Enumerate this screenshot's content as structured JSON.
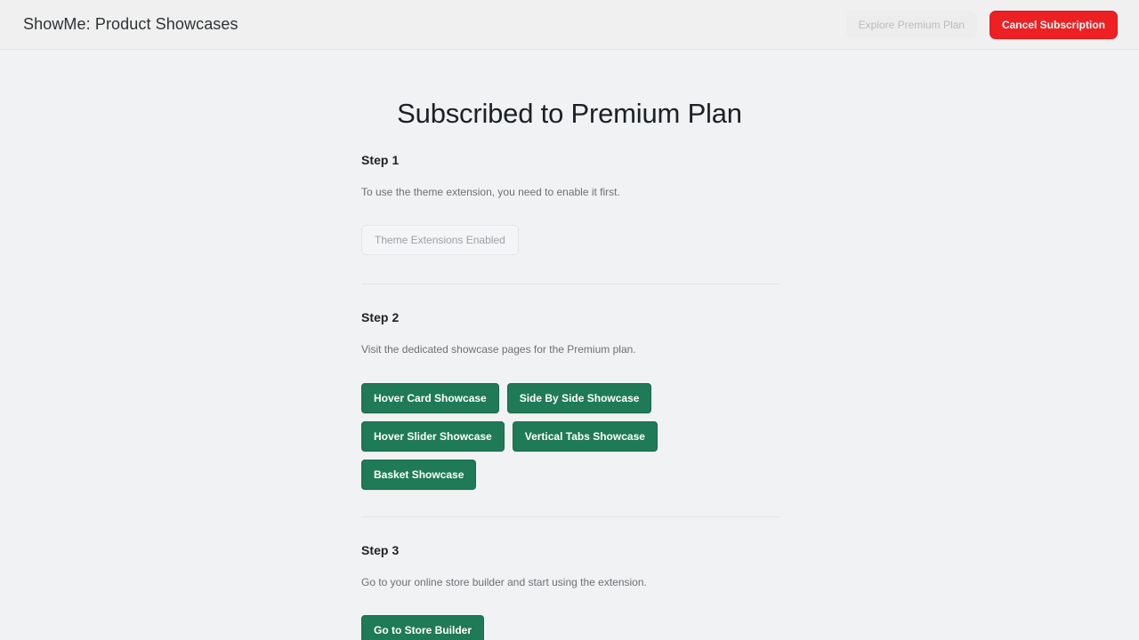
{
  "header": {
    "app_title": "ShowMe: Product Showcases",
    "explore_button": "Explore Premium Plan",
    "cancel_button": "Cancel Subscription",
    "colors": {
      "danger": "#ed2024",
      "bar_bg": "#f0f0f0"
    }
  },
  "page": {
    "title": "Subscribed to Premium Plan",
    "background": "#f1f2f4",
    "accent_green": "#1f7a57"
  },
  "steps": [
    {
      "title": "Step 1",
      "description": "To use the theme extension, you need to enable it first.",
      "action_label": "Theme Extensions Enabled"
    },
    {
      "title": "Step 2",
      "description": "Visit the dedicated showcase pages for the Premium plan.",
      "buttons": [
        "Hover Card Showcase",
        "Side By Side Showcase",
        "Hover Slider Showcase",
        "Vertical Tabs Showcase",
        "Basket Showcase"
      ]
    },
    {
      "title": "Step 3",
      "description": "Go to your online store builder and start using the extension.",
      "action_label": "Go to Store Builder"
    }
  ]
}
